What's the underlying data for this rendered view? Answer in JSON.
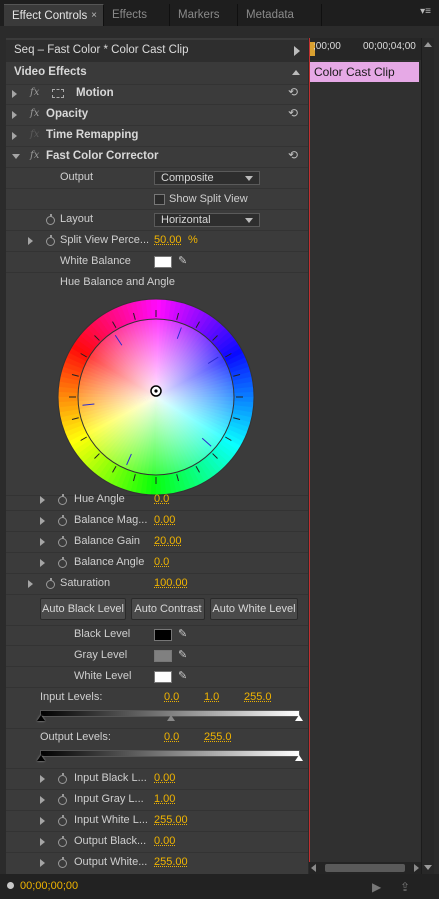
{
  "tabs": [
    {
      "label": "Effect Controls",
      "close": "×"
    },
    {
      "label": "Effects"
    },
    {
      "label": "Markers"
    },
    {
      "label": "Metadata"
    }
  ],
  "panel_menu": "▾≡",
  "sequence_label": "Seq – Fast Color * Color Cast Clip",
  "timeline": {
    "ruler_start": ";00;00",
    "ruler_end": "00;00;04;00",
    "clip_label": "Color Cast Clip",
    "clip_color": "#e6a9e6",
    "playhead_color": "#c03030"
  },
  "video_effects_header": "Video Effects",
  "effects": {
    "motion": "Motion",
    "opacity": "Opacity",
    "time_remapping": "Time Remapping",
    "fast_color_corrector": "Fast Color Corrector"
  },
  "fx_symbol": "fx",
  "reset_symbol": "⟲",
  "output": {
    "label": "Output",
    "value": "Composite"
  },
  "show_split_view": {
    "label": "Show Split View",
    "checked": false
  },
  "layout": {
    "label": "Layout",
    "value": "Horizontal"
  },
  "split_view_percent": {
    "label": "Split View Perce...",
    "value": "50.00",
    "unit": "%"
  },
  "white_balance": {
    "label": "White Balance",
    "color": "#ffffff"
  },
  "hue_balance_title": "Hue Balance and Angle",
  "hue_params": [
    {
      "label": "Hue Angle",
      "value": "0.0"
    },
    {
      "label": "Balance Mag...",
      "value": "0.00"
    },
    {
      "label": "Balance Gain",
      "value": "20.00"
    },
    {
      "label": "Balance Angle",
      "value": "0.0"
    }
  ],
  "saturation": {
    "label": "Saturation",
    "value": "100.00"
  },
  "buttons": {
    "auto_black": "Auto Black Level",
    "auto_contrast": "Auto Contrast",
    "auto_white": "Auto White Level"
  },
  "levels": [
    {
      "label": "Black Level",
      "color": "#000000"
    },
    {
      "label": "Gray Level",
      "color": "#808080"
    },
    {
      "label": "White Level",
      "color": "#ffffff"
    }
  ],
  "input_levels": {
    "label": "Input Levels:",
    "v1": "0.0",
    "v2": "1.0",
    "v3": "255.0"
  },
  "output_levels": {
    "label": "Output Levels:",
    "v1": "0.0",
    "v2": "255.0"
  },
  "level_params": [
    {
      "label": "Input Black L...",
      "value": "0.00"
    },
    {
      "label": "Input Gray L...",
      "value": "1.00"
    },
    {
      "label": "Input White L...",
      "value": "255.00"
    },
    {
      "label": "Output Black...",
      "value": "0.00"
    },
    {
      "label": "Output White...",
      "value": "255.00"
    }
  ],
  "status": {
    "timecode": "00;00;00;00"
  },
  "value_color": "#f0b400"
}
